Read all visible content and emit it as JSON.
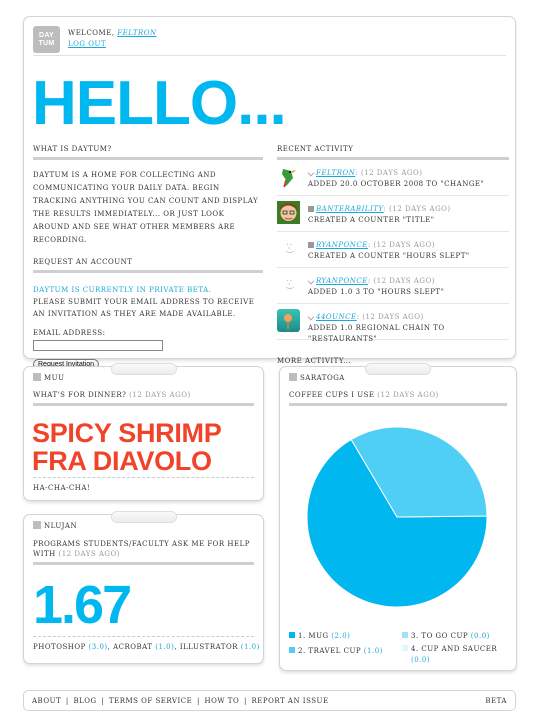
{
  "header": {
    "logo_line1": "DAY",
    "logo_line2": "TUM",
    "welcome_label": "WELCOME,",
    "username": "FELTRON",
    "logout_label": "LOG OUT",
    "hero": "HELLO..."
  },
  "about": {
    "heading": "WHAT IS DAYTUM?",
    "body": "DAYTUM IS A HOME FOR COLLECTING AND COMMUNICATING YOUR DAILY DATA. BEGIN TRACKING ANYTHING YOU CAN COUNT AND DISPLAY THE RESULTS IMMEDIATELY... OR JUST LOOK AROUND AND SEE WHAT OTHER MEMBERS ARE RECORDING.",
    "request_heading": "REQUEST AN ACCOUNT",
    "beta_notice": "DAYTUM IS CURRENTLY IN PRIVATE BETA.",
    "submit_message": "PLEASE SUBMIT YOUR EMAIL ADDRESS TO RECEIVE AN INVITATION AS THEY ARE MADE AVAILABLE.",
    "email_label": "EMAIL ADDRESS:",
    "email_value": "",
    "button_label": "Request Invitation"
  },
  "activity": {
    "heading": "RECENT ACTIVITY",
    "items": [
      {
        "user": "FELTRON",
        "when": ": (12 DAYS AGO)",
        "action": "ADDED 20.0 OCTOBER 2008 TO \"CHANGE\""
      },
      {
        "user": "BANTERABILITY",
        "when": ": (12 DAYS AGO)",
        "action": "CREATED A COUNTER \"TITLE\""
      },
      {
        "user": "RYANPONCE",
        "when": ": (12 DAYS AGO)",
        "action": "CREATED A COUNTER \"HOURS SLEPT\""
      },
      {
        "user": "RYANPONCE",
        "when": ": (12 DAYS AGO)",
        "action": "ADDED 1.0 3 TO \"HOURS SLEPT\""
      },
      {
        "user": "44OUNCE",
        "when": ": (12 DAYS AGO)",
        "action": "ADDED 1.0 REGIONAL CHAIN TO \"RESTAURANTS\""
      }
    ],
    "smiley": ":-)",
    "more_label": "MORE ACTIVITY..."
  },
  "muu": {
    "owner": "MUU",
    "question": "WHAT'S FOR DINNER?",
    "when": "(12 DAYS AGO)",
    "answer_line1": "SPICY SHRIMP",
    "answer_line2": "FRA DIAVOLO",
    "note": "HA-CHA-CHA!"
  },
  "nlujan": {
    "owner": "NLUJAN",
    "question": "PROGRAMS STUDENTS/FACULTY ASK ME FOR HELP WITH",
    "when": "(12 DAYS AGO)",
    "value": "1.67",
    "footer_items": [
      {
        "label": "PHOTOSHOP",
        "value": "(3.0)"
      },
      {
        "label": "ACROBAT",
        "value": "(1.0)"
      },
      {
        "label": "ILLUSTRATOR",
        "value": "(1.0)"
      }
    ]
  },
  "saratoga": {
    "owner": "SARATOGA",
    "title": "COFFEE CUPS I USE",
    "when": "(12 DAYS AGO)"
  },
  "chart_data": {
    "type": "pie",
    "title": "COFFEE CUPS I USE",
    "categories": [
      "1. MUG",
      "2. TRAVEL CUP",
      "3. TO GO CUP",
      "4. CUP AND SAUCER"
    ],
    "values": [
      2.0,
      1.0,
      0.0,
      0.0
    ],
    "value_labels": [
      "(2.0)",
      "(1.0)",
      "(0.0)",
      "(0.0)"
    ],
    "colors": [
      "#00b7ef",
      "#4fcff5",
      "#9fe2f9",
      "#e2f6fd"
    ],
    "legend_position": "bottom"
  },
  "footer": {
    "links": [
      "ABOUT",
      "BLOG",
      "TERMS OF SERVICE",
      "HOW TO",
      "REPORT AN ISSUE"
    ],
    "separator": "|",
    "right": "BETA"
  }
}
